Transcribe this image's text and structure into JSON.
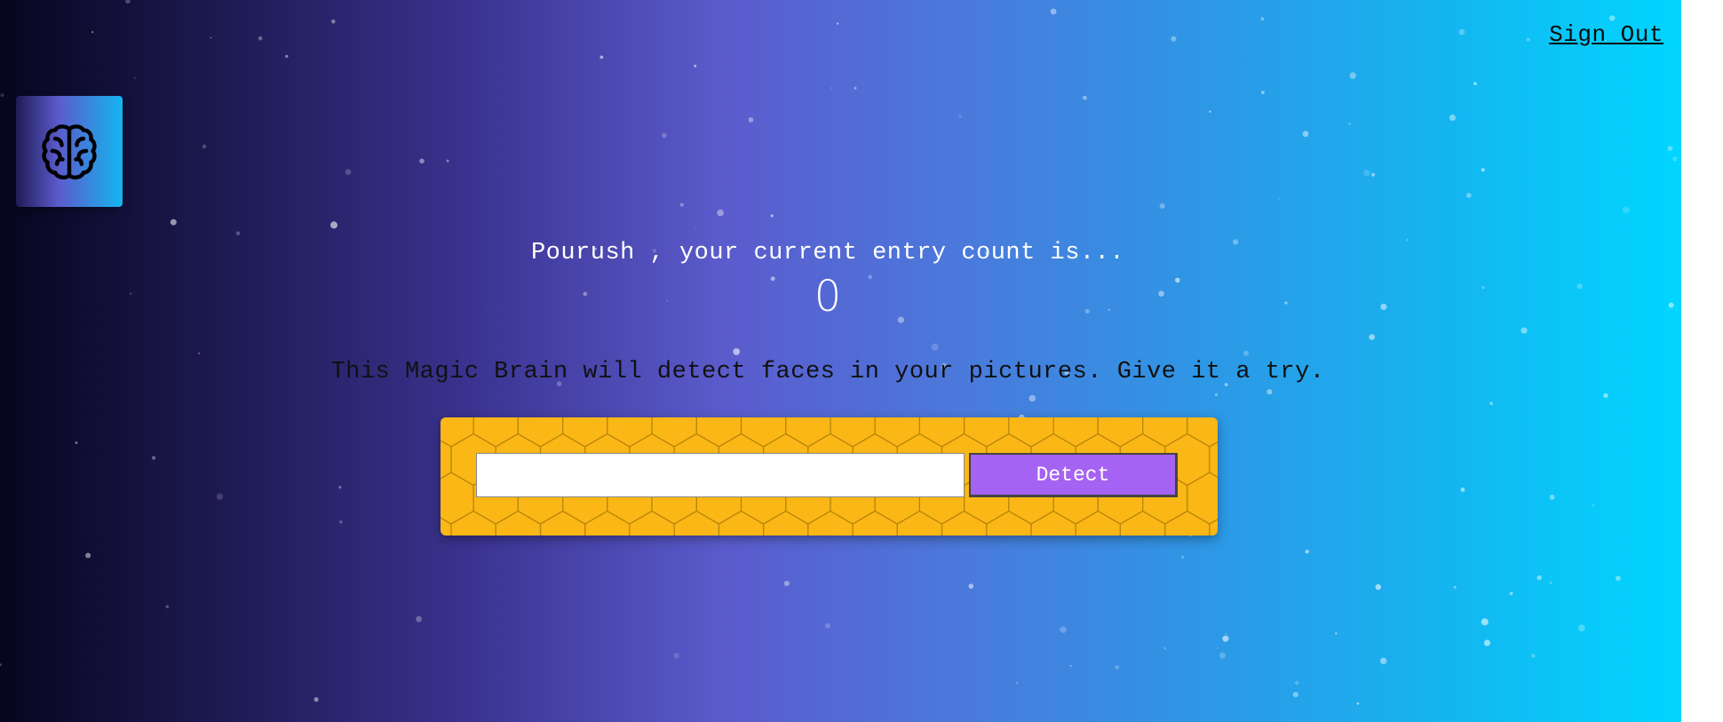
{
  "nav": {
    "sign_out_label": "Sign Out"
  },
  "logo": {
    "icon": "brain-icon"
  },
  "rank": {
    "message": "Pourush , your current entry count is...",
    "count": "0"
  },
  "tagline": "This Magic Brain will detect faces in your pictures. Give it a try.",
  "form": {
    "input_value": "",
    "detect_label": "Detect"
  },
  "colors": {
    "gradient": [
      "#06061f",
      "#1f1b55",
      "#3a3390",
      "#5b5bcc",
      "#4b79dc",
      "#2d98e6",
      "#15b5f0",
      "#00d6ff"
    ],
    "form_bg": "#fbb715",
    "detect_button": "#a463f2"
  }
}
